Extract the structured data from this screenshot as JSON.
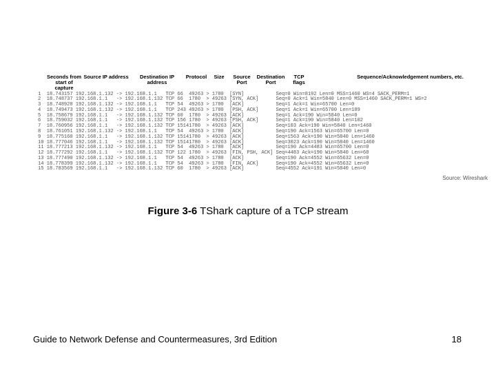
{
  "headers": {
    "num": "",
    "seconds": "Seconds from start of capture",
    "src_ip": "Source IP address",
    "dst_ip": "Destination IP address",
    "protocol": "Protocol",
    "size": "Size",
    "src_port": "Source Port",
    "dst_port": "Destination Port",
    "tcp_flags": "TCP flags",
    "seq_ack": "Sequence/Acknowledgement numbers, etc."
  },
  "packets": [
    {
      "n": "1",
      "t": "18.743157",
      "sip": "192.168.1.132",
      "dip": "192.168.1.1",
      "p": "TCP",
      "sz": "66",
      "sp": "49263",
      "dp": "1780",
      "f": "[SYN]",
      "info": "Seq=0 Win=8192 Len=0 MSS=1460 WS=4 SACK_PERM=1"
    },
    {
      "n": "2",
      "t": "18.748737",
      "sip": "192.168.1.1",
      "dip": "192.168.1.132",
      "p": "TCP",
      "sz": "66",
      "sp": "1780",
      "dp": "49263",
      "f": "[SYN, ACK]",
      "info": "Seq=0 Ack=1 Win=5840 Len=0 MSS=1460 SACK_PERM=1 WS=2"
    },
    {
      "n": "3",
      "t": "18.748920",
      "sip": "192.168.1.132",
      "dip": "192.168.1.1",
      "p": "TCP",
      "sz": "54",
      "sp": "49263",
      "dp": "1780",
      "f": "[ACK]",
      "info": "Seq=1 Ack=1 Win=65700 Len=0"
    },
    {
      "n": "4",
      "t": "18.749473",
      "sip": "192.168.1.132",
      "dip": "192.168.1.1",
      "p": "TCP",
      "sz": "243",
      "sp": "49263",
      "dp": "1780",
      "f": "[PSH, ACK]",
      "info": "Seq=1 Ack=1 Win=65700 Len=189"
    },
    {
      "n": "5",
      "t": "18.758679",
      "sip": "192.168.1.1",
      "dip": "192.168.1.132",
      "p": "TCP",
      "sz": "60",
      "sp": "1780",
      "dp": "49263",
      "f": "[ACK]",
      "info": "Seq=1 Ack=190 Win=5840 Len=0"
    },
    {
      "n": "6",
      "t": "18.759032",
      "sip": "192.168.1.1",
      "dip": "192.168.1.132",
      "p": "TCP",
      "sz": "156",
      "sp": "1780",
      "dp": "49263",
      "f": "[PSH, ACK]",
      "info": "Seq=1 Ack=190 Win=5840 Len=102"
    },
    {
      "n": "7",
      "t": "18.760956",
      "sip": "192.168.1.1",
      "dip": "192.168.1.132",
      "p": "TCP",
      "sz": "1514",
      "sp": "1780",
      "dp": "49263",
      "f": "[ACK]",
      "info": "Seq=103 Ack=190 Win=5840 Len=1460"
    },
    {
      "n": "8",
      "t": "18.761051",
      "sip": "192.168.1.132",
      "dip": "192.168.1.1",
      "p": "TCP",
      "sz": "54",
      "sp": "49263",
      "dp": "1780",
      "f": "[ACK]",
      "info": "Seq=190 Ack=1563 Win=65700 Len=0"
    },
    {
      "n": "9",
      "t": "18.775160",
      "sip": "192.168.1.1",
      "dip": "192.168.1.132",
      "p": "TCP",
      "sz": "1514",
      "sp": "1780",
      "dp": "49263",
      "f": "[ACK]",
      "info": "Seq=1563 Ack=190 Win=5840 Len=1460"
    },
    {
      "n": "10",
      "t": "18.777046",
      "sip": "192.168.1.1",
      "dip": "192.168.1.132",
      "p": "TCP",
      "sz": "1514",
      "sp": "1780",
      "dp": "49263",
      "f": "[ACK]",
      "info": "Seq=3023 Ack=190 Win=5840 Len=1460"
    },
    {
      "n": "11",
      "t": "18.777213",
      "sip": "192.168.1.132",
      "dip": "192.168.1.1",
      "p": "TCP",
      "sz": "54",
      "sp": "49263",
      "dp": "1780",
      "f": "[ACK]",
      "info": "Seq=190 Ack=4483 Win=65700 Len=0"
    },
    {
      "n": "12",
      "t": "18.777292",
      "sip": "192.168.1.1",
      "dip": "192.168.1.132",
      "p": "TCP",
      "sz": "122",
      "sp": "1780",
      "dp": "49263",
      "f": "[FIN, PSH, ACK]",
      "info": "Seq=4483 Ack=190 Win=5840 Len=68"
    },
    {
      "n": "13",
      "t": "18.777490",
      "sip": "192.168.1.132",
      "dip": "192.168.1.1",
      "p": "TCP",
      "sz": "54",
      "sp": "49263",
      "dp": "1780",
      "f": "[ACK]",
      "info": "Seq=190 Ack=4552 Win=65632 Len=0"
    },
    {
      "n": "14",
      "t": "18.778399",
      "sip": "192.168.1.132",
      "dip": "192.168.1.1",
      "p": "TCP",
      "sz": "54",
      "sp": "49263",
      "dp": "1780",
      "f": "[FIN, ACK]",
      "info": "Seq=190 Ack=4552 Win=65632 Len=0"
    },
    {
      "n": "15",
      "t": "18.783569",
      "sip": "192.168.1.1",
      "dip": "192.168.1.132",
      "p": "TCP",
      "sz": "60",
      "sp": "1780",
      "dp": "49263",
      "f": "[ACK]",
      "info": "Seq=4552 Ack=191 Win=5840 Len=0"
    }
  ],
  "source_credit": "Source: Wireshark",
  "caption": {
    "label": "Figure 3-6",
    "text": "  TShark capture of a TCP stream"
  },
  "footer": {
    "left": "Guide to Network Defense and Countermeasures, 3rd Edition",
    "right": "18"
  }
}
